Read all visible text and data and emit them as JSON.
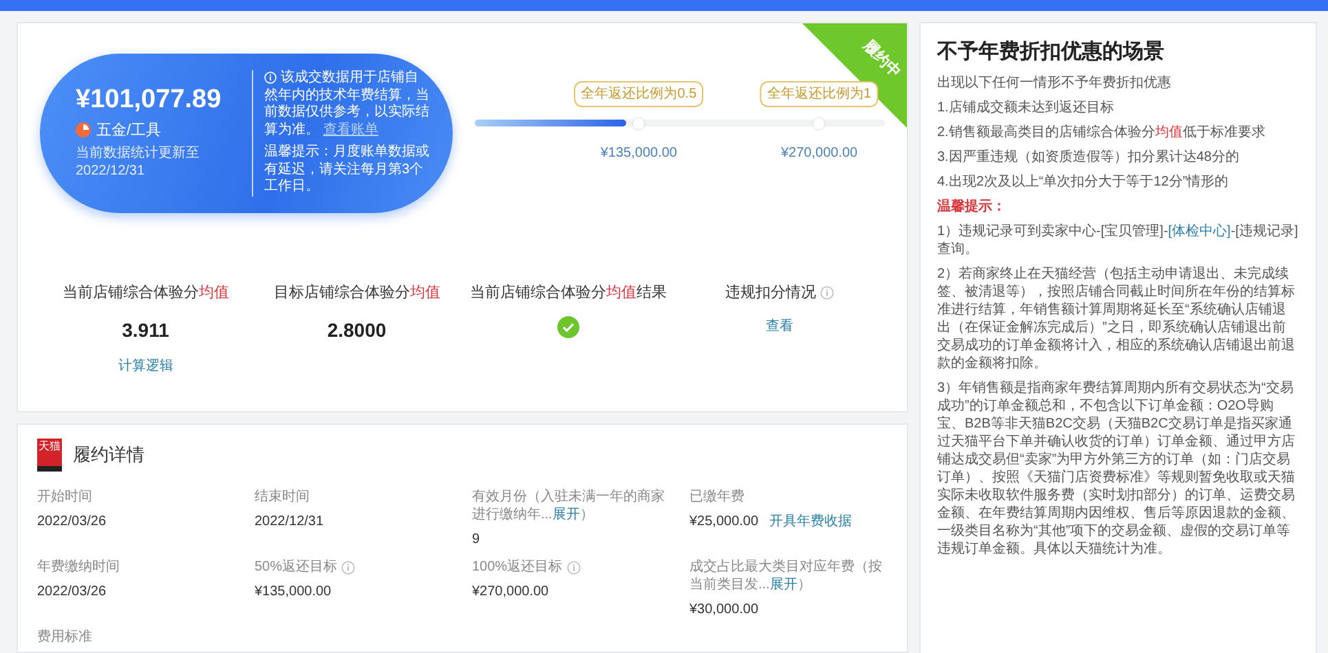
{
  "status_tag": "履约中",
  "fee_summary": {
    "amount": "¥101,077.89",
    "category": "五金/工具",
    "update_label": "当前数据统计更新至",
    "update_date": "2022/12/31",
    "note": "该成交数据用于店铺自然年内的技术年费结算，当前数据仅供参考，以实际结算为准。",
    "note_link": "查看账单",
    "reminder": "温馨提示：月度账单数据或有延迟，请关注每月第3个工作日。"
  },
  "progress": {
    "level": 0.37,
    "milestones": [
      {
        "tag": "全年返还比例为0.5",
        "amount": "¥135,000.00"
      },
      {
        "tag": "全年返还比例为1",
        "amount": "¥270,000.00"
      }
    ]
  },
  "metrics": [
    {
      "kind": "value",
      "label": "当前店铺综合体验分",
      "highlight": "均值",
      "value": "3.911",
      "link": "计算逻辑"
    },
    {
      "kind": "value",
      "label": "目标店铺综合体验分",
      "highlight": "均值",
      "value": "2.8000"
    },
    {
      "kind": "check",
      "label": "当前店铺综合体验分",
      "highlight": "均值",
      "suffix": "结果",
      "passed": true
    },
    {
      "kind": "value",
      "label": "违规扣分情况",
      "info": true,
      "link": "查看"
    }
  ],
  "scenarios": {
    "title": "不予年费折扣优惠的场景",
    "intro": "出现以下任何一情形不予年费折扣优惠",
    "items": [
      {
        "text": "1.店铺成交额未达到返还目标"
      },
      {
        "text": "2.销售额最高类目的店铺综合体验分",
        "highlight": "均值",
        "rest": "低于标准要求"
      },
      {
        "text": "3.因严重违规（如资质造假等）扣分累计达48分的"
      },
      {
        "text": "4.出现2次及以上“单次扣分大于等于12分”情形的"
      }
    ],
    "warning_title": "温馨提示：",
    "notes": [
      {
        "text": "1）违规记录可到卖家中心-[宝贝管理]-",
        "link": "[体检中心]",
        "rest": "-[违规记录]查询。"
      },
      {
        "text": "2）若商家终止在天猫经营（包括主动申请退出、未完成续签、被清退等），按照店铺合同截止时间所在年份的结算标准进行结算，年销售额计算周期将延长至“系统确认店铺退出（在保证金解冻完成后）”之日，即系统确认店铺退出前交易成功的订单金额将计入，相应的系统确认店铺退出前退款的金额将扣除。"
      },
      {
        "text": "3）年销售额是指商家年费结算周期内所有交易状态为“交易成功”的订单金额总和，不包含以下订单金额：O2O导购宝、B2B等非天猫B2C交易（天猫B2C交易订单是指买家通过天猫平台下单并确认收货的订单）订单金额、通过甲方店铺达成交易但“卖家”为甲方外第三方的订单（如：门店交易订单）、按照《天猫门店资费标准》等规则暂免收取或天猫实际未收取软件服务费（实时划扣部分）的订单、运费交易金额、在年费结算周期内因维权、售后等原因退款的金额、一级类目名称为“其他”项下的交易金额、虚假的交易订单等违规订单金额。具体以天猫统计为准。"
      }
    ]
  },
  "details": {
    "logo_text": "天猫",
    "title": "履约详情",
    "fields": [
      {
        "label": "开始时间",
        "value": "2022/03/26"
      },
      {
        "label": "结束时间",
        "value": "2022/12/31"
      },
      {
        "label": "有效月份（入驻未满一年的商家进行缴纳年...",
        "label_link": "展开",
        "label_end": "）",
        "value": "9"
      },
      {
        "label": "已缴年费",
        "value": "¥25,000.00",
        "action": "开具年费收据"
      },
      {
        "label": "年费缴纳时间",
        "value": "2022/03/26"
      },
      {
        "label": "50%返还目标",
        "info": true,
        "value": "¥135,000.00"
      },
      {
        "label": "100%返还目标",
        "info": true,
        "value": "¥270,000.00"
      },
      {
        "label": "成交占比最大类目对应年费（按当前类目发...",
        "label_link": "展开",
        "label_end": "）",
        "value": "¥30,000.00"
      },
      {
        "label": "费用标准"
      }
    ]
  }
}
